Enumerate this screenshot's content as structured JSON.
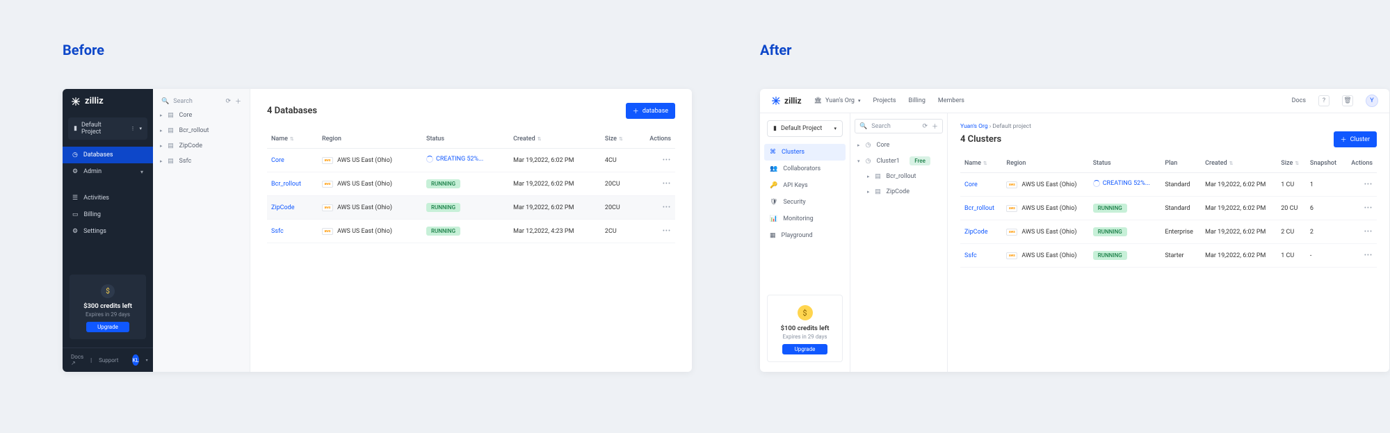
{
  "labels": {
    "before": "Before",
    "after": "After"
  },
  "brand": "zilliz",
  "before": {
    "project_label": "Default Project",
    "nav": {
      "databases": "Databases",
      "admin": "Admin",
      "activities": "Activities",
      "billing": "Billing",
      "settings": "Settings"
    },
    "credits": {
      "title": "$300 credits left",
      "sub": "Expires in 29 days",
      "btn": "Upgrade"
    },
    "footer": {
      "docs": "Docs",
      "support": "Support",
      "avatar": "KL"
    },
    "search_placeholder": "Search",
    "tree": [
      "Core",
      "Bcr_rollout",
      "ZipCode",
      "Ssfc"
    ],
    "title": "4 Databases",
    "add_btn": "database",
    "cols": {
      "name": "Name",
      "region": "Region",
      "status": "Status",
      "created": "Created",
      "size": "Size",
      "actions": "Actions"
    },
    "region_text": "AWS US East (Ohio)",
    "rows": [
      {
        "name": "Core",
        "status": "CREATING 52%...",
        "status_kind": "creating",
        "created": "Mar 19,2022, 6:02 PM",
        "size": "4CU"
      },
      {
        "name": "Bcr_rollout",
        "status": "RUNNING",
        "status_kind": "running",
        "created": "Mar 19,2022, 6:02 PM",
        "size": "20CU"
      },
      {
        "name": "ZipCode",
        "status": "RUNNING",
        "status_kind": "running",
        "created": "Mar 19,2022, 6:02 PM",
        "size": "20CU",
        "hover": true
      },
      {
        "name": "Ssfc",
        "status": "RUNNING",
        "status_kind": "running",
        "created": "Mar 12,2022, 4:23 PM",
        "size": "2CU"
      }
    ]
  },
  "after": {
    "org": "Yuan's Org",
    "topnav": {
      "projects": "Projects",
      "billing": "Billing",
      "members": "Members",
      "docs": "Docs"
    },
    "avatar": "Y",
    "project_label": "Default Project",
    "nav": {
      "clusters": "Clusters",
      "collaborators": "Collaborators",
      "apikeys": "API Keys",
      "security": "Security",
      "monitoring": "Monitoring",
      "playground": "Playground"
    },
    "credits": {
      "title": "$100 credits left",
      "sub": "Expires in 29 days",
      "btn": "Upgrade"
    },
    "search_placeholder": "Search",
    "tree_core": "Core",
    "tree_cluster1": "Cluster1",
    "tree_cluster1_badge": "Free",
    "tree_children": [
      "Bcr_rollout",
      "ZipCode"
    ],
    "crumb_org": "Yuan's Org",
    "crumb_proj": "Default project",
    "title": "4 Clusters",
    "add_btn": "Cluster",
    "cols": {
      "name": "Name",
      "region": "Region",
      "status": "Status",
      "plan": "Plan",
      "created": "Created",
      "size": "Size",
      "snapshot": "Snapshot",
      "actions": "Actions"
    },
    "region_text": "AWS US East (Ohio)",
    "rows": [
      {
        "name": "Core",
        "status": "CREATING 52%...",
        "status_kind": "creating",
        "plan": "Standard",
        "created": "Mar 19,2022, 6:02 PM",
        "size": "1 CU",
        "snapshot": "1"
      },
      {
        "name": "Bcr_rollout",
        "status": "RUNNING",
        "status_kind": "running",
        "plan": "Standard",
        "created": "Mar 19,2022, 6:02 PM",
        "size": "20 CU",
        "snapshot": "6"
      },
      {
        "name": "ZipCode",
        "status": "RUNNING",
        "status_kind": "running",
        "plan": "Enterprise",
        "created": "Mar 19,2022, 6:02 PM",
        "size": "2 CU",
        "snapshot": "2"
      },
      {
        "name": "Ssfc",
        "status": "RUNNING",
        "status_kind": "running",
        "plan": "Starter",
        "created": "Mar 19,2022, 6:02 PM",
        "size": "1 CU",
        "snapshot": "-"
      }
    ]
  }
}
